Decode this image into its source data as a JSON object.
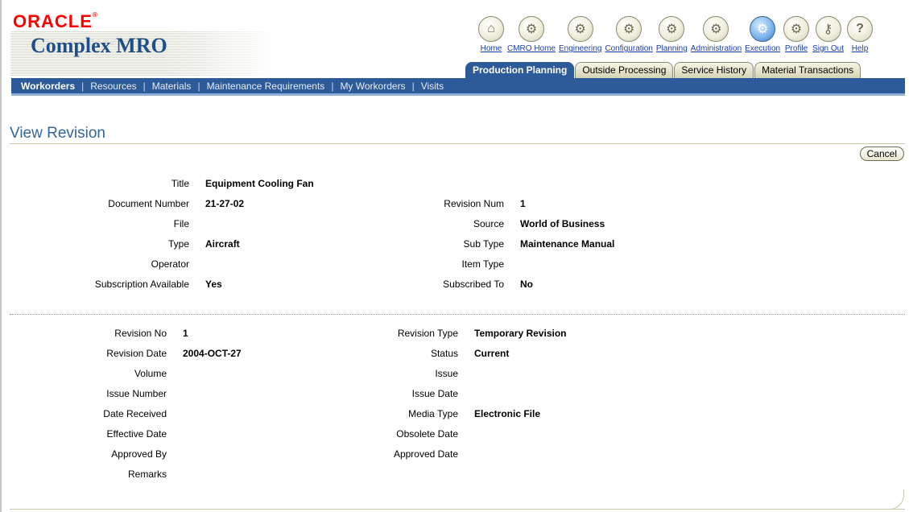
{
  "branding": {
    "oracle": "ORACLE",
    "product": "Complex MRO"
  },
  "global_buttons": [
    {
      "label": "Home",
      "icon": "home-icon"
    },
    {
      "label": "CMRO Home",
      "icon": "cmro-home-icon"
    },
    {
      "label": "Engineering",
      "icon": "engineering-icon"
    },
    {
      "label": "Configuration",
      "icon": "configuration-icon"
    },
    {
      "label": "Planning",
      "icon": "planning-icon"
    },
    {
      "label": "Administration",
      "icon": "administration-icon"
    },
    {
      "label": "Execution",
      "icon": "execution-icon"
    },
    {
      "label": "Profile",
      "icon": "profile-icon"
    },
    {
      "label": "Sign Out",
      "icon": "sign-out-icon"
    },
    {
      "label": "Help",
      "icon": "help-icon"
    }
  ],
  "tabs": [
    {
      "label": "Production Planning",
      "active": true
    },
    {
      "label": "Outside Processing"
    },
    {
      "label": "Service History"
    },
    {
      "label": "Material Transactions"
    }
  ],
  "subnav": [
    {
      "label": "Workorders",
      "active": true
    },
    {
      "label": "Resources"
    },
    {
      "label": "Materials"
    },
    {
      "label": "Maintenance Requirements"
    },
    {
      "label": "My Workorders"
    },
    {
      "label": "Visits"
    }
  ],
  "page": {
    "title": "View Revision",
    "cancel_label": "Cancel"
  },
  "document": {
    "title_label": "Title",
    "title_value": "Equipment Cooling Fan",
    "document_number_label": "Document Number",
    "document_number_value": "21-27-02",
    "revision_num_label": "Revision Num",
    "revision_num_value": "1",
    "file_label": "File",
    "source_label": "Source",
    "source_value": "World of Business",
    "type_label": "Type",
    "type_value": "Aircraft",
    "sub_type_label": "Sub Type",
    "sub_type_value": "Maintenance Manual",
    "operator_label": "Operator",
    "item_type_label": "Item Type",
    "subscription_label": "Subscription Available",
    "subscription_value": "Yes",
    "subscribed_to_label": "Subscribed To",
    "subscribed_to_value": "No"
  },
  "revision": {
    "revision_no_label": "Revision No",
    "revision_no_value": "1",
    "revision_type_label": "Revision Type",
    "revision_type_value": "Temporary Revision",
    "revision_date_label": "Revision Date",
    "revision_date_value": "2004-OCT-27",
    "status_label": "Status",
    "status_value": "Current",
    "volume_label": "Volume",
    "issue_label": "Issue",
    "issue_number_label": "Issue Number",
    "issue_date_label": "Issue Date",
    "date_received_label": "Date Received",
    "media_type_label": "Media Type",
    "media_type_value": "Electronic File",
    "effective_date_label": "Effective Date",
    "obsolete_date_label": "Obsolete Date",
    "approved_by_label": "Approved By",
    "approved_date_label": "Approved Date",
    "remarks_label": "Remarks"
  },
  "colors": {
    "brand_blue": "#2d5a99",
    "title_blue": "#336699",
    "logo_red": "#ff0000",
    "link_blue": "#1a3eab"
  }
}
